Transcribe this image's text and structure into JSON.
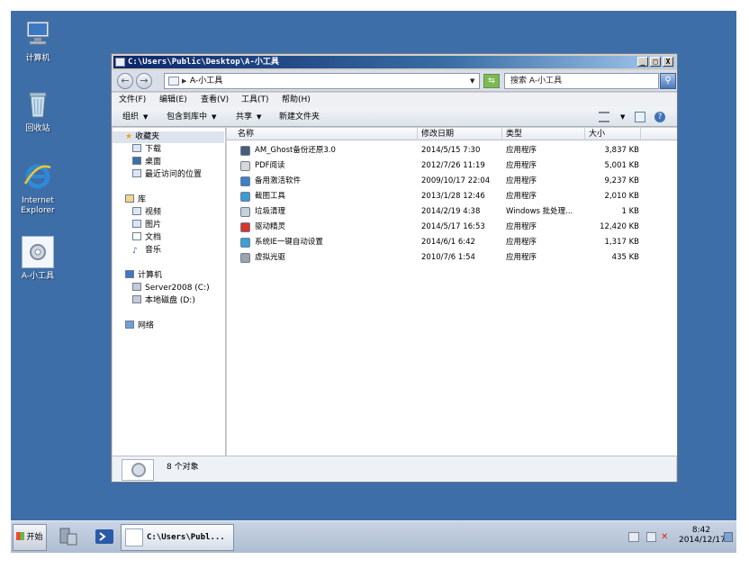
{
  "desktop": {
    "icons": [
      {
        "label": "计算机",
        "icon": "computer-icon"
      },
      {
        "label": "回收站",
        "icon": "recycle-bin-icon"
      },
      {
        "label_line1": "Internet",
        "label_line2": "Explorer",
        "icon": "internet-explorer-icon"
      },
      {
        "label": "A-小工具",
        "icon": "folder-gear-icon"
      }
    ]
  },
  "window": {
    "title": "C:\\Users\\Public\\Desktop\\A-小工具",
    "controls": {
      "minimize": "_",
      "maximize": "□",
      "close": "X"
    },
    "address": "A-小工具",
    "search_placeholder": "搜索 A-小工具",
    "menu": [
      "文件(F)",
      "编辑(E)",
      "查看(V)",
      "工具(T)",
      "帮助(H)"
    ],
    "toolbar": [
      "组织",
      "包含到库中",
      "共享",
      "新建文件夹"
    ],
    "nav": {
      "favorites": "收藏夹",
      "fav_items": [
        "下载",
        "桌面",
        "最近访问的位置"
      ],
      "libraries": "库",
      "lib_items": [
        "视频",
        "图片",
        "文档",
        "音乐"
      ],
      "computer": "计算机",
      "comp_items": [
        "Server2008 (C:)",
        "本地磁盘 (D:)"
      ],
      "network": "网络"
    },
    "columns": [
      "名称",
      "修改日期",
      "类型",
      "大小"
    ],
    "files": [
      {
        "name": "AM_Ghost备份还原3.0",
        "date": "2014/5/15 7:30",
        "type": "应用程序",
        "size": "3,837 KB",
        "color": "#4a5a78"
      },
      {
        "name": "PDF阅读",
        "date": "2012/7/26 11:19",
        "type": "应用程序",
        "size": "5,001 KB",
        "color": "#d8d8d8"
      },
      {
        "name": "备用激活软件",
        "date": "2009/10/17 22:04",
        "type": "应用程序",
        "size": "9,237 KB",
        "color": "#3f7fc6"
      },
      {
        "name": "截图工具",
        "date": "2013/1/28 12:46",
        "type": "应用程序",
        "size": "2,010 KB",
        "color": "#3e9ad6"
      },
      {
        "name": "垃圾清理",
        "date": "2014/2/19 4:38",
        "type": "Windows 批处理...",
        "size": "1 KB",
        "color": "#c7cfda"
      },
      {
        "name": "驱动精灵",
        "date": "2014/5/17 16:53",
        "type": "应用程序",
        "size": "12,420 KB",
        "color": "#d9322d"
      },
      {
        "name": "系统IE一键自动设置",
        "date": "2014/6/1 6:42",
        "type": "应用程序",
        "size": "1,317 KB",
        "color": "#3aa0d8"
      },
      {
        "name": "虚拟光驱",
        "date": "2010/7/6 1:54",
        "type": "应用程序",
        "size": "435 KB",
        "color": "#9aa3ae"
      }
    ],
    "status": "8 个对象"
  },
  "taskbar": {
    "start": "开始",
    "task_title": "C:\\Users\\Publ...",
    "time": "8:42",
    "date": "2014/12/17"
  }
}
